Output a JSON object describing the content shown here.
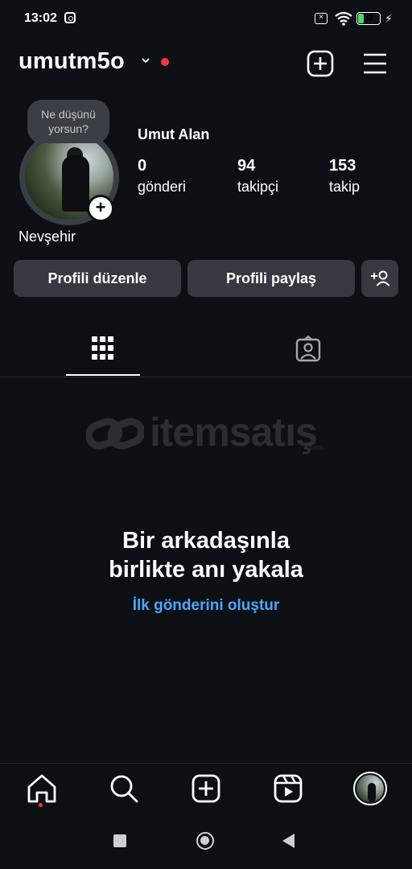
{
  "status_bar": {
    "time": "13:02",
    "battery": "33",
    "battery_level": 0.33
  },
  "header": {
    "username": "umutm5o"
  },
  "profile": {
    "note": "Ne düşünü yorsun?",
    "full_name": "Umut Alan",
    "city": "Nevşehir",
    "stats": [
      {
        "value": "0",
        "label": "gönderi"
      },
      {
        "value": "94",
        "label": "takipçi"
      },
      {
        "value": "153",
        "label": "takip"
      }
    ]
  },
  "actions": {
    "edit_profile": "Profili düzenle",
    "share_profile": "Profili paylaş"
  },
  "watermark": {
    "text": "itemsatış",
    "suffix": ".com"
  },
  "empty_state": {
    "title_line1": "Bir arkadaşınla",
    "title_line2": "birlikte anı yakala",
    "link": "İlk gönderini oluştur"
  },
  "colors": {
    "background": "#0c1014",
    "button": "#363a40",
    "link": "#4aa8ff",
    "notification": "#ff3040"
  },
  "icons": {
    "status": [
      "instagram-icon",
      "sim-icon",
      "wifi-icon",
      "battery-icon",
      "charging-icon"
    ],
    "header": [
      "chevron-down-icon",
      "add-post-icon",
      "menu-icon"
    ],
    "tabs": [
      "grid-icon",
      "tagged-icon"
    ],
    "nav": [
      "home-icon",
      "search-icon",
      "create-icon",
      "reels-icon",
      "profile-avatar"
    ]
  }
}
